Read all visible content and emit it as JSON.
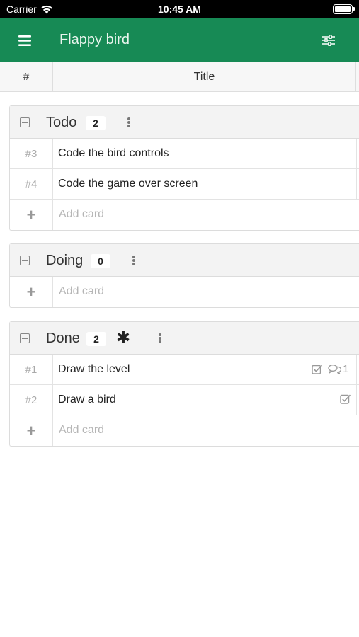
{
  "status_bar": {
    "carrier": "Carrier",
    "time": "10:45 AM"
  },
  "app_bar": {
    "title": "Flappy bird",
    "menu_icon": "hamburger-menu-icon",
    "filter_icon": "sliders-icon"
  },
  "table_header": {
    "number_col": "#",
    "title_col": "Title"
  },
  "groups": [
    {
      "name": "Todo",
      "count": "2",
      "cards": [
        {
          "number": "#3",
          "title": "Code the bird controls"
        },
        {
          "number": "#4",
          "title": "Code the game over screen"
        }
      ],
      "add_label": "Add card"
    },
    {
      "name": "Doing",
      "count": "0",
      "cards": [],
      "add_label": "Add card"
    },
    {
      "name": "Done",
      "count": "2",
      "marker": "✱",
      "cards": [
        {
          "number": "#1",
          "title": "Draw the level",
          "has_checklist": true,
          "comments": "1"
        },
        {
          "number": "#2",
          "title": "Draw a bird",
          "has_checklist": true
        }
      ],
      "add_label": "Add card"
    }
  ],
  "colors": {
    "app_bar": "#178a55",
    "status_bar": "#000000"
  }
}
